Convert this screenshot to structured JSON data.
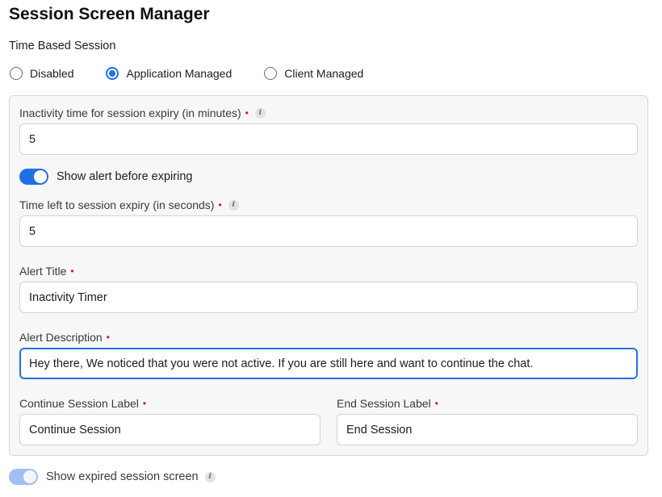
{
  "page": {
    "title": "Session Screen Manager",
    "section_label": "Time Based Session"
  },
  "session_mode": {
    "options": [
      {
        "label": "Disabled",
        "selected": false
      },
      {
        "label": "Application Managed",
        "selected": true
      },
      {
        "label": "Client Managed",
        "selected": false
      }
    ]
  },
  "form": {
    "inactivity": {
      "label": "Inactivity time for session expiry (in minutes)",
      "required_marker": "•",
      "value": "5",
      "info_icon": "info-icon"
    },
    "show_alert": {
      "label": "Show alert before expiring",
      "enabled": true
    },
    "time_left": {
      "label": "Time left to session expiry (in seconds)",
      "required_marker": "•",
      "value": "5",
      "info_icon": "info-icon"
    },
    "alert_title": {
      "label": "Alert Title",
      "required_marker": "•",
      "value": "Inactivity Timer"
    },
    "alert_description": {
      "label": "Alert Description",
      "required_marker": "•",
      "value": "Hey there, We noticed that you were not active. If you are still here and want to continue the chat."
    },
    "continue_label": {
      "label": "Continue Session Label",
      "required_marker": "•",
      "value": "Continue Session"
    },
    "end_label": {
      "label": "End Session Label",
      "required_marker": "•",
      "value": "End Session"
    }
  },
  "expired_screen": {
    "label": "Show expired session screen",
    "enabled": true,
    "disabled_control": true,
    "info_icon": "info-icon"
  },
  "colors": {
    "accent": "#1f6fe5",
    "required": "#c0134d",
    "panel_bg": "#f7f7f8",
    "toggle_disabled": "#9ec0f4"
  }
}
